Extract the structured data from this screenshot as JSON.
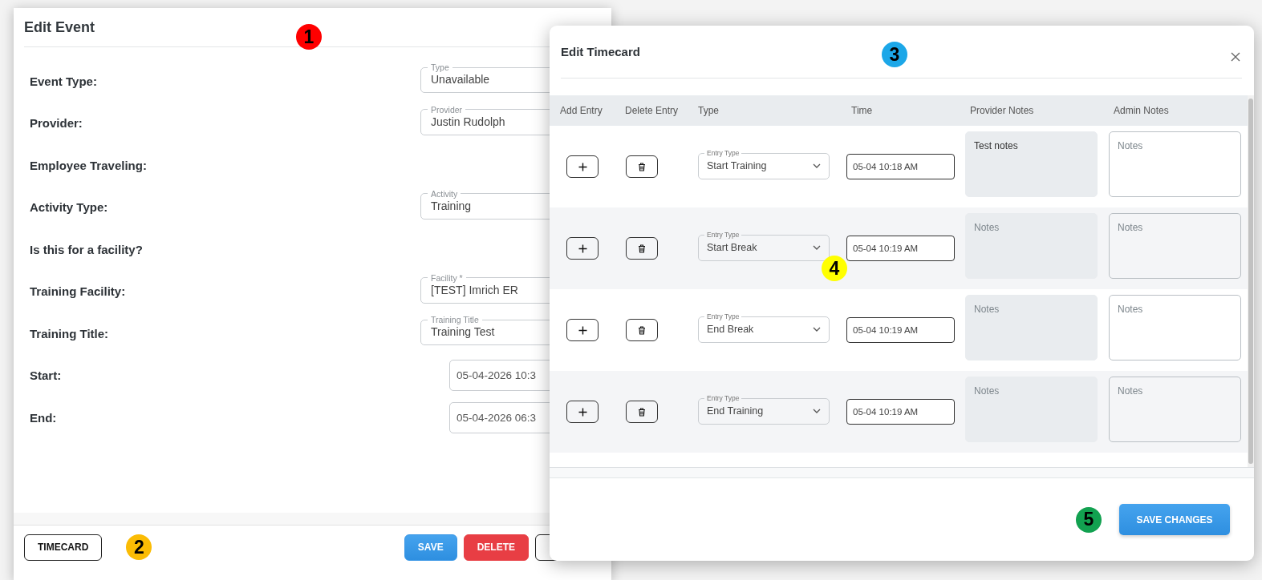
{
  "event_dialog": {
    "title": "Edit Event",
    "rows": [
      {
        "label": "Event Type:",
        "field": {
          "kind": "select",
          "label": "Type",
          "value": "Unavailable"
        }
      },
      {
        "label": "Provider:",
        "field": {
          "kind": "select",
          "label": "Provider",
          "value": "Justin Rudolph"
        }
      },
      {
        "label": "Employee Traveling:"
      },
      {
        "label": "Activity Type:",
        "field": {
          "kind": "select",
          "label": "Activity",
          "value": "Training"
        }
      },
      {
        "label": "Is this for a facility?"
      },
      {
        "label": "Training Facility:",
        "field": {
          "kind": "select",
          "label": "Facility *",
          "value": "[TEST] Imrich ER"
        }
      },
      {
        "label": "Training Title:",
        "field": {
          "kind": "text",
          "label": "Training Title",
          "value": "Training Test"
        }
      },
      {
        "label": "Start:",
        "field": {
          "kind": "date",
          "value": "05-04-2026 10:3"
        }
      },
      {
        "label": "End:",
        "field": {
          "kind": "date",
          "value": "05-04-2026 06:3"
        }
      }
    ],
    "timecard_button": "TIMECARD",
    "buttons": [
      {
        "label": "SAVE",
        "kind": "primary"
      },
      {
        "label": "DELETE",
        "kind": "danger"
      },
      {
        "kind": "outline"
      }
    ]
  },
  "timecard_dialog": {
    "title": "Edit Timecard",
    "columns": [
      "Add Entry",
      "Delete Entry",
      "Type",
      "Time",
      "Provider Notes",
      "Admin Notes"
    ],
    "rows": [
      {
        "entry_type_label": "Entry Type",
        "entry_type": "Start Training",
        "time": "05-04 10:18 AM",
        "provider_notes": {
          "value": "Test notes"
        },
        "admin_notes": {
          "placeholder": "Notes"
        }
      },
      {
        "entry_type_label": "Entry Type",
        "entry_type": "Start Break",
        "time": "05-04 10:19 AM",
        "provider_notes": {
          "placeholder": "Notes"
        },
        "admin_notes": {
          "placeholder": "Notes"
        }
      },
      {
        "entry_type_label": "Entry Type",
        "entry_type": "End Break",
        "time": "05-04 10:19 AM",
        "provider_notes": {
          "placeholder": "Notes"
        },
        "admin_notes": {
          "placeholder": "Notes"
        }
      },
      {
        "entry_type_label": "Entry Type",
        "entry_type": "End Training",
        "time": "05-04 10:19 AM",
        "provider_notes": {
          "placeholder": "Notes"
        },
        "admin_notes": {
          "placeholder": "Notes"
        }
      }
    ],
    "save_button": "SAVE CHANGES"
  },
  "markers": [
    {
      "label": "1",
      "color": "#ff0000"
    },
    {
      "label": "2",
      "color": "#fbbc04"
    },
    {
      "label": "3",
      "color": "#1ca7e8"
    },
    {
      "label": "4",
      "color": "#ffff00"
    },
    {
      "label": "5",
      "color": "#12a150"
    }
  ]
}
